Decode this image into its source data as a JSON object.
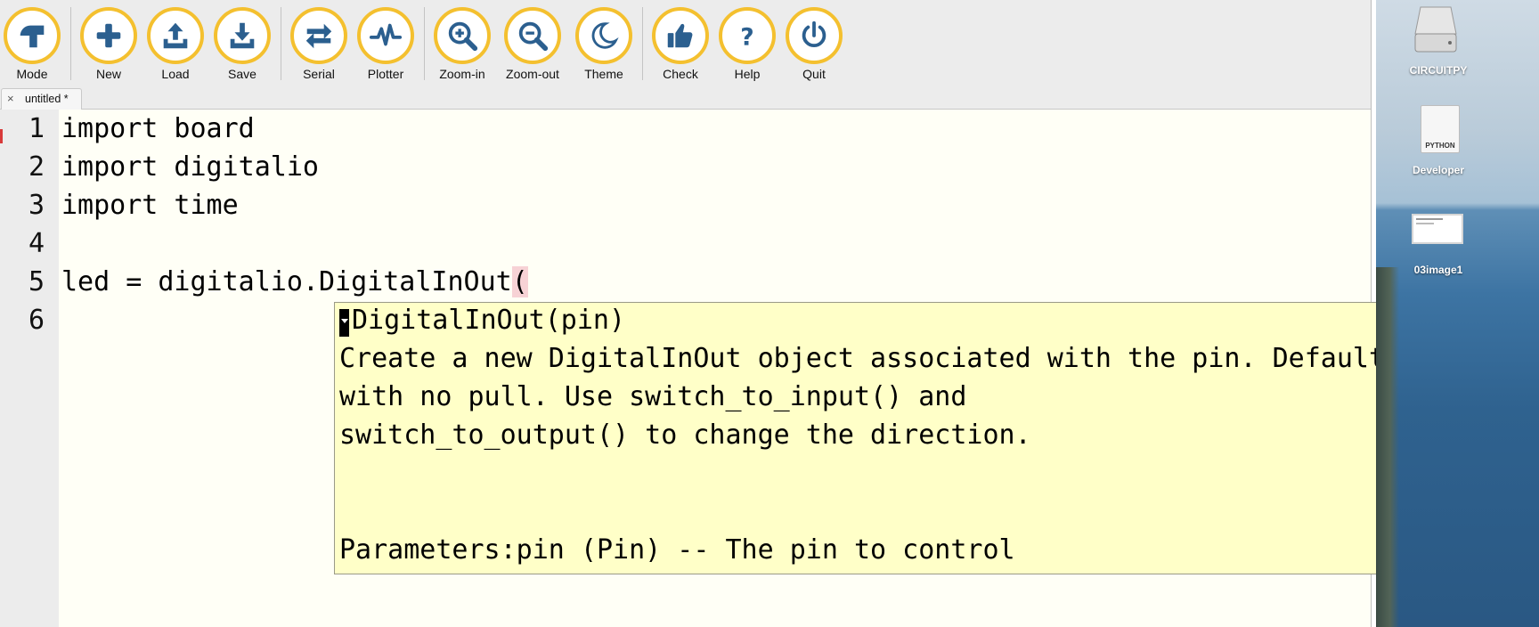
{
  "toolbar": {
    "buttons": [
      {
        "label": "Mode",
        "icon": "mode-icon"
      },
      {
        "label": "New",
        "icon": "plus-icon"
      },
      {
        "label": "Load",
        "icon": "upload-icon"
      },
      {
        "label": "Save",
        "icon": "download-icon"
      },
      {
        "label": "Serial",
        "icon": "arrows-swap-icon"
      },
      {
        "label": "Plotter",
        "icon": "pulse-icon"
      },
      {
        "label": "Zoom-in",
        "icon": "zoom-in-icon"
      },
      {
        "label": "Zoom-out",
        "icon": "zoom-out-icon"
      },
      {
        "label": "Theme",
        "icon": "moon-icon"
      },
      {
        "label": "Check",
        "icon": "thumbs-up-icon"
      },
      {
        "label": "Help",
        "icon": "question-icon"
      },
      {
        "label": "Quit",
        "icon": "power-icon"
      }
    ]
  },
  "tabs": [
    {
      "label": "untitled *",
      "close": "×"
    }
  ],
  "editor": {
    "line_numbers": [
      "1",
      "2",
      "3",
      "4",
      "5",
      "6"
    ],
    "lines": [
      "import board",
      "import digitalio",
      "import time",
      "",
      "led = digitalio.DigitalInOut",
      ""
    ],
    "open_paren": "("
  },
  "calltip": {
    "lines": [
      "DigitalInOut(pin)",
      "Create a new DigitalInOut object associated with the pin. Defaults to input",
      "with no pull. Use switch_to_input() and",
      "switch_to_output() to change the direction.",
      "",
      "",
      "Parameters:pin (Pin) -- The pin to control"
    ]
  },
  "desktop": {
    "icons": [
      {
        "label": "CIRCUITPY",
        "icon": "drive-icon"
      },
      {
        "label": "Developer",
        "icon": "python-file-icon",
        "badge": "PYTHON"
      },
      {
        "label": "03image1",
        "icon": "image-file-icon"
      }
    ]
  },
  "colors": {
    "accent": "#f4c02f",
    "icon_blue": "#2b5f8f",
    "editor_bg": "#fffff6",
    "calltip_bg": "#ffffc8",
    "paren_highlight": "#f7d2d5"
  }
}
